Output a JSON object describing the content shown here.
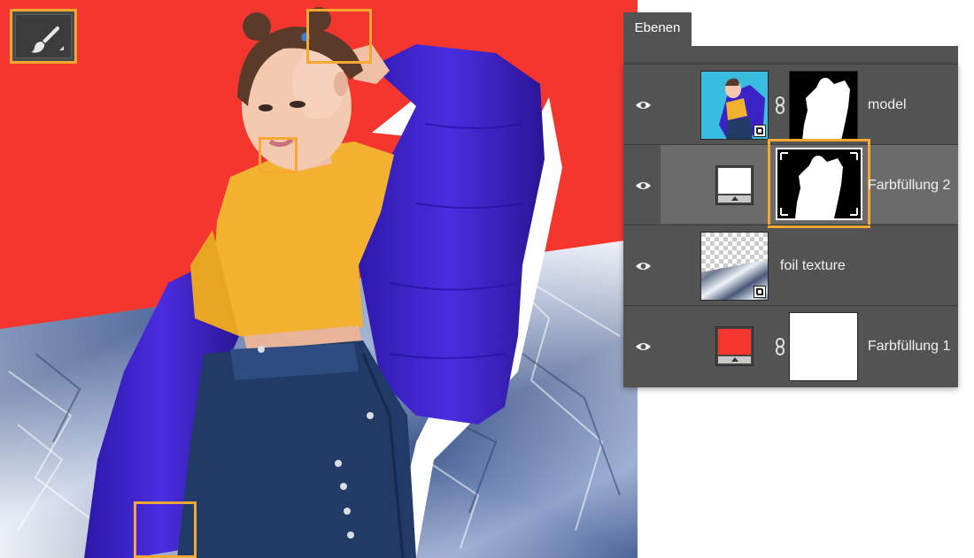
{
  "tools": {
    "active_tool": "brush-tool",
    "brush_icon": "brush-icon"
  },
  "colors": {
    "background_red": "#f5362f",
    "highlight_orange": "#f7a833",
    "sweater_yellow": "#f2b12e",
    "jacket_purple": "#3b1fc8",
    "denim_blue": "#213a66",
    "panel_bg": "#535353",
    "panel_selected": "#6b6b6b"
  },
  "layers_panel": {
    "tab_label": "Ebenen",
    "layers": [
      {
        "name": "model",
        "visible": true,
        "thumbnail": "photo",
        "mask": true,
        "smart_object": true,
        "selected": false
      },
      {
        "name": "Farbfüllung 2",
        "visible": true,
        "thumbnail": "fill-white",
        "mask": true,
        "mask_highlighted": true,
        "selected": true
      },
      {
        "name": "foil texture",
        "visible": true,
        "thumbnail": "foil",
        "mask": false,
        "smart_object": true,
        "selected": false
      },
      {
        "name": "Farbfüllung 1",
        "visible": true,
        "thumbnail": "fill-red",
        "mask": true,
        "mask_type": "white",
        "selected": false
      }
    ]
  }
}
